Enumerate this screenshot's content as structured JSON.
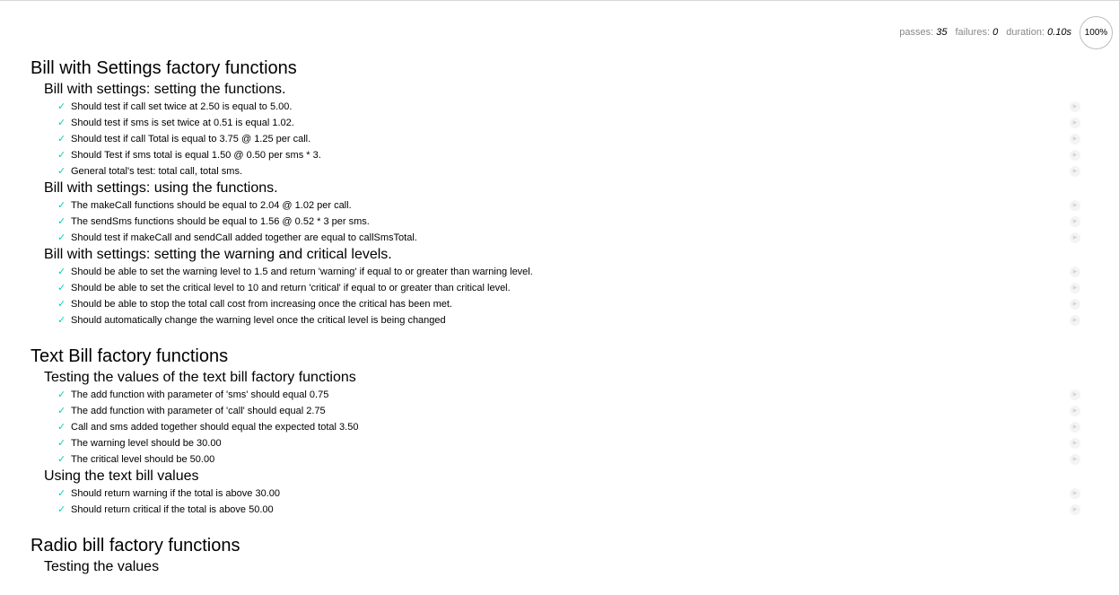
{
  "stats": {
    "passes_label": "passes:",
    "passes": "35",
    "failures_label": "failures:",
    "failures": "0",
    "duration_label": "duration:",
    "duration": "0.10",
    "duration_unit": "s",
    "progress": "100%"
  },
  "icons": {
    "check": "✓",
    "replay": "▶"
  },
  "suites": [
    {
      "title": "Bill with Settings factory functions",
      "subsuites": [
        {
          "title": "Bill with settings: setting the functions.",
          "tests": [
            "Should test if call set twice at 2.50 is equal to 5.00.",
            "Should test if sms is set twice at 0.51 is equal 1.02.",
            "Should test if call Total is equal to 3.75 @ 1.25 per call.",
            "Should Test if sms total is equal 1.50 @ 0.50 per sms * 3.",
            "General total's test: total call, total sms."
          ]
        },
        {
          "title": "Bill with settings: using the functions.",
          "tests": [
            "The makeCall functions should be equal to 2.04 @ 1.02 per call.",
            "The sendSms functions should be equal to 1.56 @ 0.52 * 3 per sms.",
            "Should test if makeCall and sendCall added together are equal to callSmsTotal."
          ]
        },
        {
          "title": "Bill with settings: setting the warning and critical levels.",
          "tests": [
            "Should be able to set the warning level to 1.5 and return 'warning' if equal to or greater than warning level.",
            "Should be able to set the critical level to 10 and return 'critical' if equal to or greater than critical level.",
            "Should be able to stop the total call cost from increasing once the critical has been met.",
            "Should automatically change the warning level once the critical level is being changed"
          ]
        }
      ]
    },
    {
      "title": "Text Bill factory functions",
      "subsuites": [
        {
          "title": "Testing the values of the text bill factory functions",
          "tests": [
            "The add function with parameter of 'sms' should equal 0.75",
            "The add function with parameter of 'call' should equal 2.75",
            "Call and sms added together should equal the expected total 3.50",
            "The warning level should be 30.00",
            "The critical level should be 50.00"
          ]
        },
        {
          "title": "Using the text bill values",
          "tests": [
            "Should return warning if the total is above 30.00",
            "Should return critical if the total is above 50.00"
          ]
        }
      ]
    },
    {
      "title": "Radio bill factory functions",
      "subsuites": [
        {
          "title": "Testing the values",
          "tests": []
        }
      ]
    }
  ]
}
